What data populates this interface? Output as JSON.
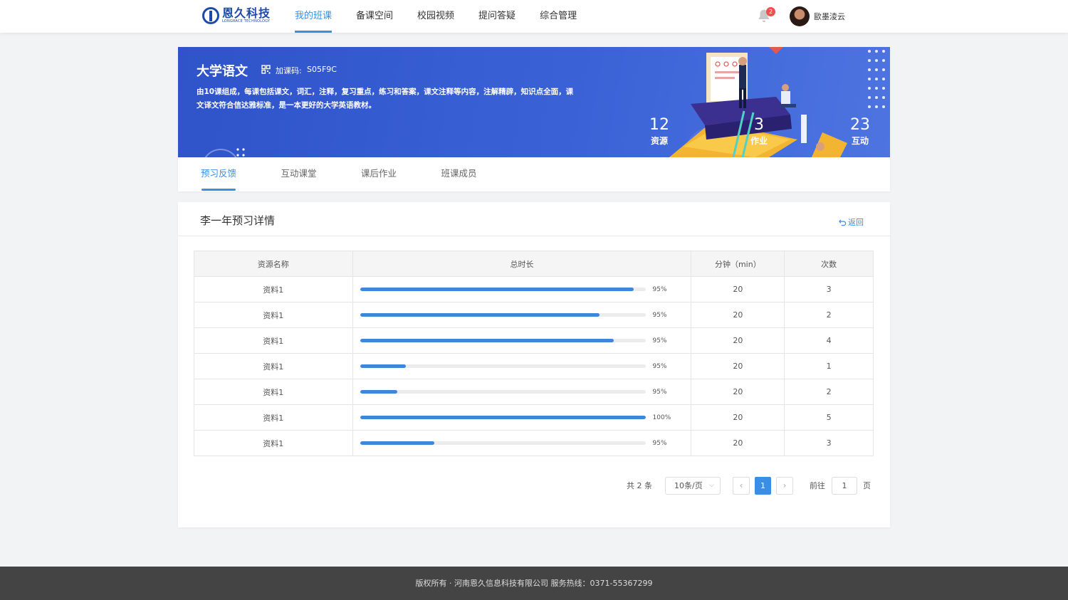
{
  "header": {
    "logo_text": "恩久科技",
    "logo_sub": "LONGRACE TECHNOLOGY",
    "nav": [
      {
        "label": "我的班课",
        "active": true
      },
      {
        "label": "备课空间",
        "active": false
      },
      {
        "label": "校园视频",
        "active": false
      },
      {
        "label": "提问答疑",
        "active": false
      },
      {
        "label": "综合管理",
        "active": false
      }
    ],
    "notification_count": "2",
    "user_name": "歐墨淩云"
  },
  "course": {
    "title": "大学语文",
    "code_label": "加课码:",
    "code_value": "S05F9C",
    "description": "由10课组成，每课包括课文，词汇，注释，复习重点，练习和答案，课文注释等内容，注解精辟，知识点全面，课文译文符合信达雅标准，是一本更好的大学英语教材。",
    "stats": [
      {
        "value": "12",
        "label": "资源"
      },
      {
        "value": "3",
        "label": "作业"
      },
      {
        "value": "23",
        "label": "互动"
      }
    ]
  },
  "tabs": [
    {
      "label": "预习反馈",
      "active": true
    },
    {
      "label": "互动课堂",
      "active": false
    },
    {
      "label": "课后作业",
      "active": false
    },
    {
      "label": "班课成员",
      "active": false
    }
  ],
  "detail": {
    "title": "李一年预习详情",
    "back_label": "返回",
    "columns": [
      "资源名称",
      "总时长",
      "分钟（min）",
      "次数"
    ],
    "rows": [
      {
        "name": "资料1",
        "progress": 0.96,
        "percent_label": "95%",
        "minutes": "20",
        "count": "3"
      },
      {
        "name": "资料1",
        "progress": 0.84,
        "percent_label": "95%",
        "minutes": "20",
        "count": "2"
      },
      {
        "name": "资料1",
        "progress": 0.89,
        "percent_label": "95%",
        "minutes": "20",
        "count": "4"
      },
      {
        "name": "资料1",
        "progress": 0.16,
        "percent_label": "95%",
        "minutes": "20",
        "count": "1"
      },
      {
        "name": "资料1",
        "progress": 0.13,
        "percent_label": "95%",
        "minutes": "20",
        "count": "2"
      },
      {
        "name": "资料1",
        "progress": 1.0,
        "percent_label": "100%",
        "minutes": "20",
        "count": "5"
      },
      {
        "name": "资料1",
        "progress": 0.26,
        "percent_label": "95%",
        "minutes": "20",
        "count": "3"
      }
    ]
  },
  "pagination": {
    "total_text": "共 2 条",
    "page_size": "10条/页",
    "current_page": "1",
    "goto_label": "前往",
    "goto_value": "1",
    "page_suffix": "页"
  },
  "footer": {
    "text": "版权所有 · 河南恩久信息科技有限公司   服务热线：0371-55367299"
  },
  "colors": {
    "accent": "#3a8ee6",
    "banner": "#3a62d6",
    "progress_fill": "#3d86dc",
    "badge": "#f04f4f",
    "footer_bg": "#444444"
  }
}
